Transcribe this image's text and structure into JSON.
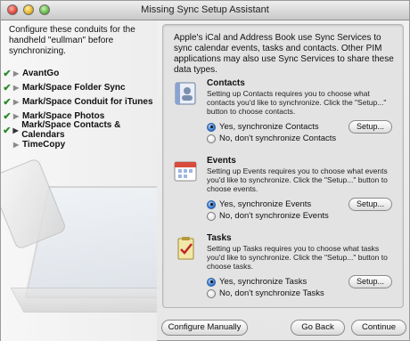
{
  "window": {
    "title": "Missing Sync Setup Assistant"
  },
  "sidebar": {
    "intro": "Configure these conduits for the handheld \"eullman\" before synchronizing.",
    "items": [
      {
        "label": "AvantGo",
        "checked": true
      },
      {
        "label": "Mark/Space Folder Sync",
        "checked": true
      },
      {
        "label": "Mark/Space Conduit for iTunes",
        "checked": true
      },
      {
        "label": "Mark/Space Photos",
        "checked": true
      },
      {
        "label": "Mark/Space Contacts & Calendars",
        "checked": true
      },
      {
        "label": "TimeCopy",
        "checked": false
      }
    ]
  },
  "panel": {
    "description": "Apple's iCal and Address Book use Sync Services to sync calendar events, tasks and contacts. Other PIM applications may also use Sync Services to share these data types.",
    "sections": [
      {
        "icon": "address-book-icon",
        "title": "Contacts",
        "description": "Setting up Contacts requires you to choose what contacts you'd like to synchronize. Click the \"Setup...\" button to choose contacts.",
        "yes": "Yes, synchronize Contacts",
        "no": "No, don't synchronize Contacts",
        "selected": "yes",
        "setup": "Setup..."
      },
      {
        "icon": "calendar-icon",
        "title": "Events",
        "description": "Setting up Events requires you to choose what events you'd like to synchronize. Click the \"Setup...\" button to choose events.",
        "yes": "Yes, synchronize Events",
        "no": "No, don't synchronize Events",
        "selected": "yes",
        "setup": "Setup..."
      },
      {
        "icon": "tasks-icon",
        "title": "Tasks",
        "description": "Setting up Tasks requires you to choose what tasks you'd like to synchronize. Click the \"Setup...\" button to choose tasks.",
        "yes": "Yes, synchronize Tasks",
        "no": "No, don't synchronize Tasks",
        "selected": "yes",
        "setup": "Setup..."
      }
    ]
  },
  "buttons": {
    "configure": "Configure Manually",
    "back": "Go Back",
    "continue": "Continue"
  }
}
